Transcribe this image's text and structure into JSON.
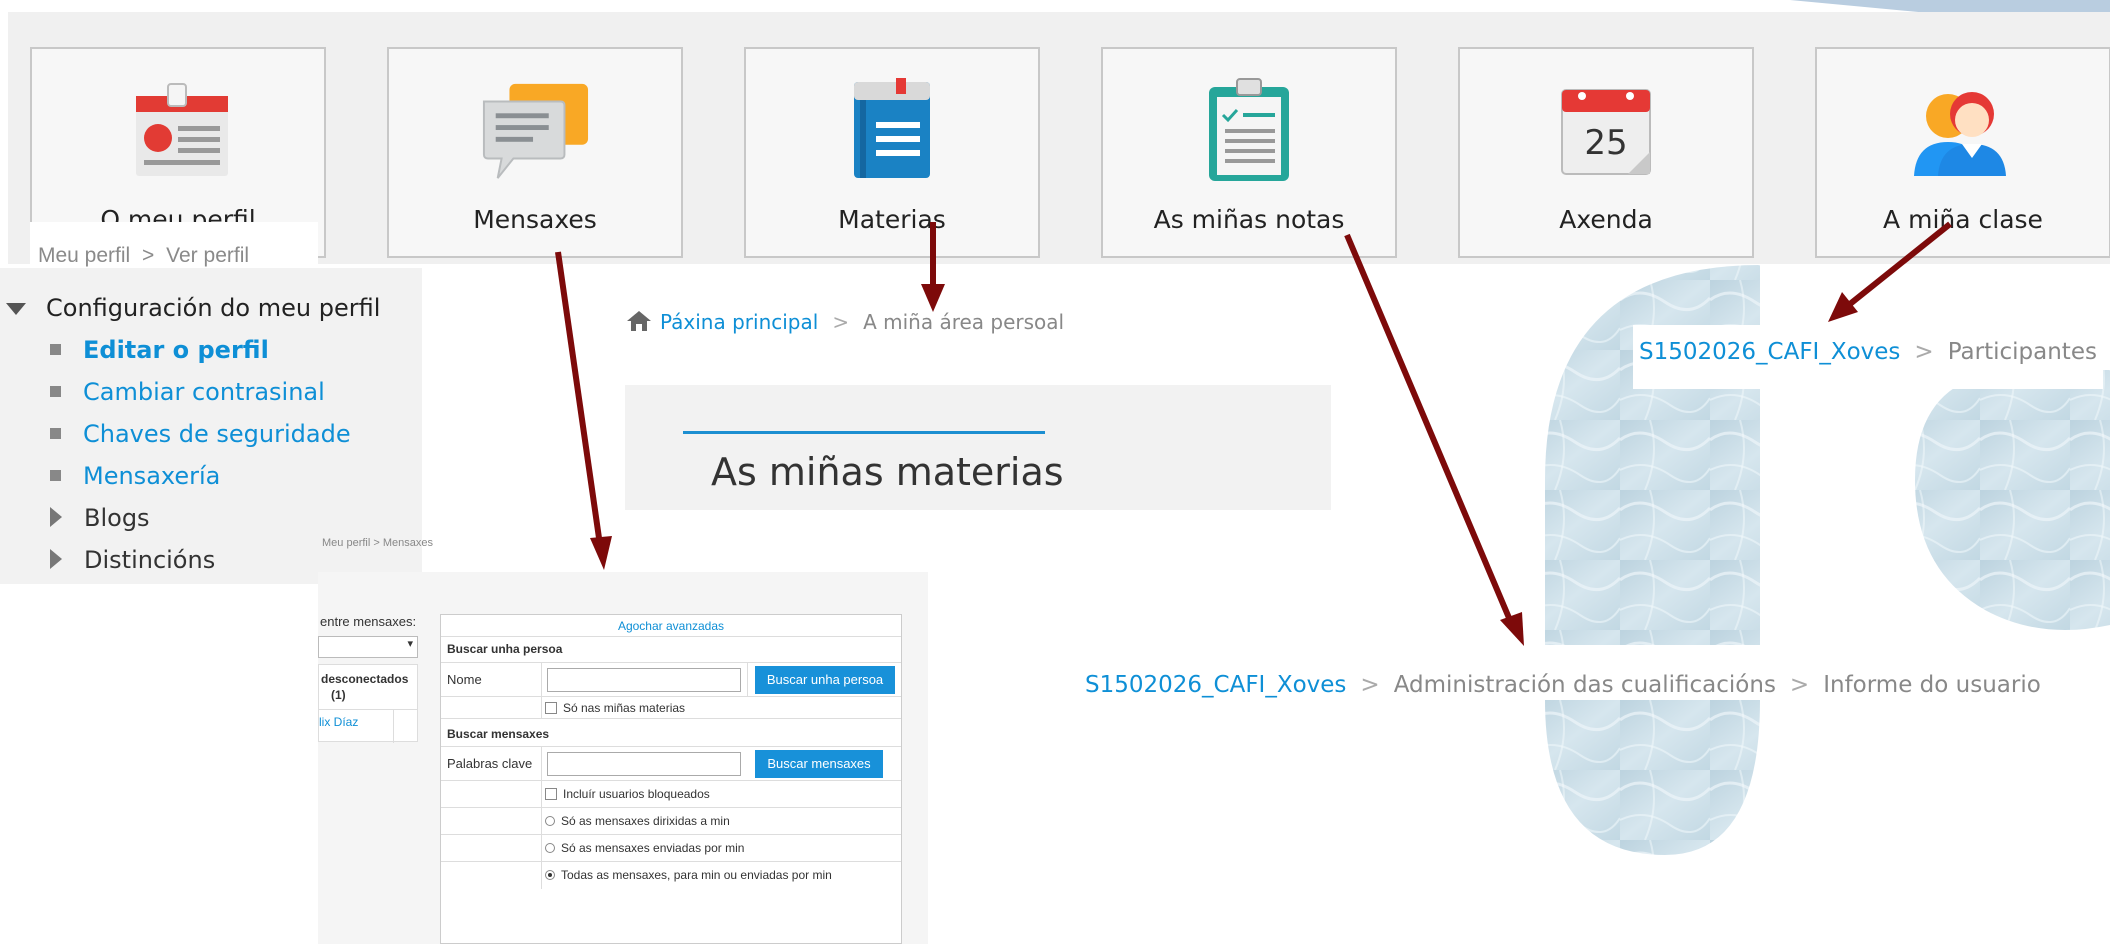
{
  "tiles": [
    {
      "label": "O meu perfil",
      "icon": "profile-card-icon"
    },
    {
      "label": "Mensaxes",
      "icon": "chat-bubbles-icon"
    },
    {
      "label": "Materias",
      "icon": "book-icon"
    },
    {
      "label": "As miñas notas",
      "icon": "clipboard-icon"
    },
    {
      "label": "Axenda",
      "icon": "calendar-icon",
      "day": "25"
    },
    {
      "label": "A miña clase",
      "icon": "users-icon"
    }
  ],
  "profile_breadcrumb": {
    "root": "Meu perfil",
    "sep": ">",
    "current": "Ver perfil"
  },
  "profile_menu": {
    "header": "Configuración do meu perfil",
    "items": [
      {
        "label": "Editar o perfil"
      },
      {
        "label": "Cambiar contrasinal"
      },
      {
        "label": "Chaves de seguridade"
      },
      {
        "label": "Mensaxería"
      },
      {
        "label": "Blogs"
      },
      {
        "label": "Distincións"
      }
    ]
  },
  "home_breadcrumb": {
    "home": "Páxina principal",
    "sep": ">",
    "current": "A miña área persoal"
  },
  "materias_panel": {
    "title": "As miñas materias"
  },
  "class_breadcrumb": {
    "course": "S1502026_CAFI_Xoves",
    "sep": ">",
    "current": "Participantes"
  },
  "grades_breadcrumb": {
    "course": "S1502026_CAFI_Xoves",
    "sep": ">",
    "section": "Administración das cualificacións",
    "sep2": ">",
    "current": "Informe do usuario"
  },
  "messages": {
    "breadcrumb": {
      "root": "Meu perfil",
      "sep": ">",
      "current": "Mensaxes"
    },
    "side_label": "entre mensaxes:",
    "select_arrow": "▾",
    "offline_header": "desconectados",
    "offline_count": "(1)",
    "contact": "lix Díaz",
    "toggle_advanced": "Agochar avanzadas",
    "search_person_title": "Buscar unha persoa",
    "name_label": "Nome",
    "search_person_button": "Buscar unha persoa",
    "only_my_courses": "Só nas miñas materias",
    "search_messages_title": "Buscar mensaxes",
    "keywords_label": "Palabras clave",
    "search_messages_button": "Buscar mensaxes",
    "include_blocked": "Incluír usuarios bloqueados",
    "option_to_me": "Só as mensaxes dirixidas a min",
    "option_from_me": "Só as mensaxes enviadas por min",
    "option_all": "Todas as mensaxes, para min ou enviadas por min"
  },
  "colors": {
    "accent": "#0e8fd6",
    "arrow": "#7d0a0a",
    "button": "#1891d9"
  }
}
